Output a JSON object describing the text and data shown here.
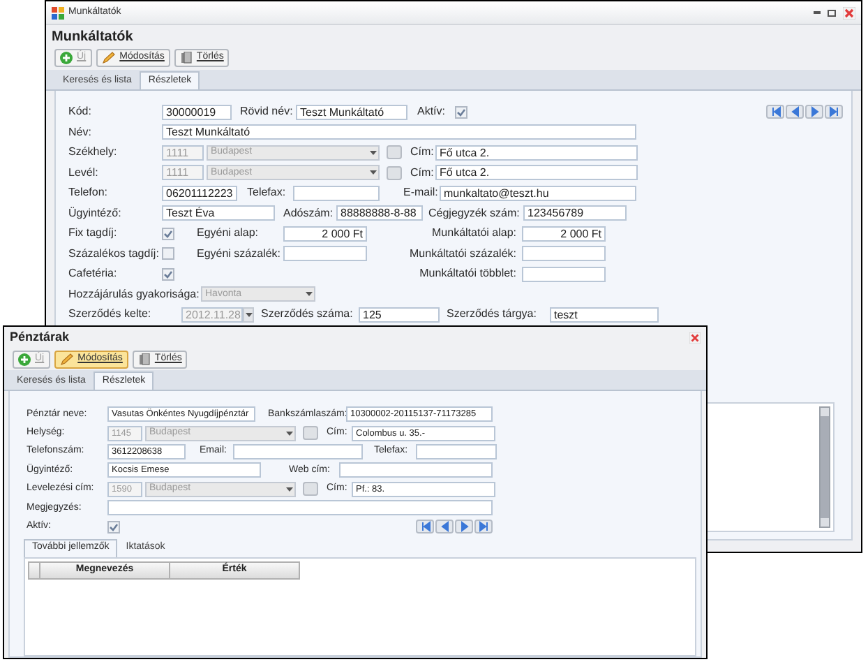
{
  "back": {
    "title": "Munkáltatók",
    "heading": "Munkáltatók",
    "toolbar": [
      {
        "kind": "add",
        "label": "Új",
        "disabled": true,
        "highlighted": false
      },
      {
        "kind": "edit",
        "label": "Módosítás",
        "disabled": false,
        "highlighted": false
      },
      {
        "kind": "delete",
        "label": "Törlés",
        "disabled": false,
        "highlighted": false
      }
    ],
    "tabs": [
      {
        "label": "Keresés és lista",
        "selected": false
      },
      {
        "label": "Részletek",
        "selected": true
      }
    ],
    "code": {
      "label": "Kód:",
      "value": "30000019"
    },
    "short_name": {
      "label": "Rövid név:",
      "value": "Teszt Munkáltató"
    },
    "active": {
      "label": "Aktív:",
      "checked": true
    },
    "name": {
      "label": "Név:",
      "value": "Teszt Munkáltató"
    },
    "seat": {
      "label": "Székhely:",
      "zip": "1111",
      "city": "Budapest",
      "disabled": true,
      "address_label": "Cím:",
      "address": "Fő utca 2."
    },
    "mailing": {
      "label": "Levél:",
      "zip": "1111",
      "city": "Budapest",
      "disabled": true,
      "address_label": "Cím:",
      "address": "Fő utca 2."
    },
    "phone": {
      "label": "Telefon:",
      "value": "06201112223"
    },
    "fax": {
      "label": "Telefax:"
    },
    "email": {
      "label": "E-mail:",
      "value": "munkaltato@teszt.hu"
    },
    "contact": {
      "label": "Ügyintéző:",
      "value": "Teszt Éva"
    },
    "tax": {
      "label": "Adószám:",
      "value": "88888888-8-88"
    },
    "registry": {
      "label": "Cégjegyzék szám:",
      "value": "123456789"
    },
    "fixed_fee": {
      "label": "Fix tagdíj:",
      "checked": true
    },
    "percent_fee": {
      "label": "Százalékos tagdíj:",
      "checked": false
    },
    "cafeteria": {
      "label": "Cafetéria:",
      "checked": true
    },
    "individual_base": {
      "label": "Egyéni alap:",
      "value": "2 000 Ft"
    },
    "individual_percent": {
      "label": "Egyéni százalék:"
    },
    "employer_base": {
      "label": "Munkáltatói alap:",
      "value": "2 000 Ft"
    },
    "employer_percent": {
      "label": "Munkáltatói százalék:"
    },
    "employer_extra": {
      "label": "Munkáltatói többlet:"
    },
    "frequency": {
      "label": "Hozzájárulás gyakorisága:",
      "value": "Havonta",
      "disabled": true
    },
    "contract_date": {
      "label": "Szerződés kelte:",
      "value": "2012.11.28",
      "disabled": true
    },
    "contract_number": {
      "label": "Szerződés száma:",
      "value": "125"
    },
    "contract_subject": {
      "label": "Szerződés tárgya:",
      "value": "teszt"
    }
  },
  "front": {
    "heading": "Pénztárak",
    "toolbar": [
      {
        "kind": "add",
        "label": "Új",
        "disabled": true,
        "highlighted": false
      },
      {
        "kind": "edit",
        "label": "Módosítás",
        "disabled": false,
        "highlighted": true
      },
      {
        "kind": "delete",
        "label": "Törlés",
        "disabled": false,
        "highlighted": false
      }
    ],
    "tabs": [
      {
        "label": "Keresés és lista",
        "selected": false
      },
      {
        "label": "Részletek",
        "selected": true
      }
    ],
    "fund_name": {
      "label": "Pénztár neve:",
      "value": "Vasutas Önkéntes Nyugdíjpénztár"
    },
    "bank_account": {
      "label": "Bankszámlaszám:",
      "value": "10300002-20115137-71173285"
    },
    "locality": {
      "label": "Helység:",
      "zip": "1145",
      "city": "Budapest",
      "disabled": true,
      "address_label": "Cím:",
      "address": "Colombus u. 35.-"
    },
    "phone": {
      "label": "Telefonszám:",
      "value": "3612208638"
    },
    "email": {
      "label": "Email:"
    },
    "fax": {
      "label": "Telefax:"
    },
    "contact": {
      "label": "Ügyintéző:",
      "value": "Kocsis Emese"
    },
    "web": {
      "label": "Web cím:"
    },
    "mailing": {
      "label": "Levelezési cím:",
      "zip": "1590",
      "city": "Budapest",
      "disabled": true,
      "address_label": "Cím:",
      "address": "Pf.: 83."
    },
    "note": {
      "label": "Megjegyzés:"
    },
    "active": {
      "label": "Aktív:",
      "checked": true
    },
    "subtabs": [
      {
        "label": "További jellemzők",
        "selected": true
      },
      {
        "label": "Iktatások",
        "selected": false
      }
    ],
    "grid_columns": [
      "Megnevezés",
      "Érték"
    ]
  }
}
